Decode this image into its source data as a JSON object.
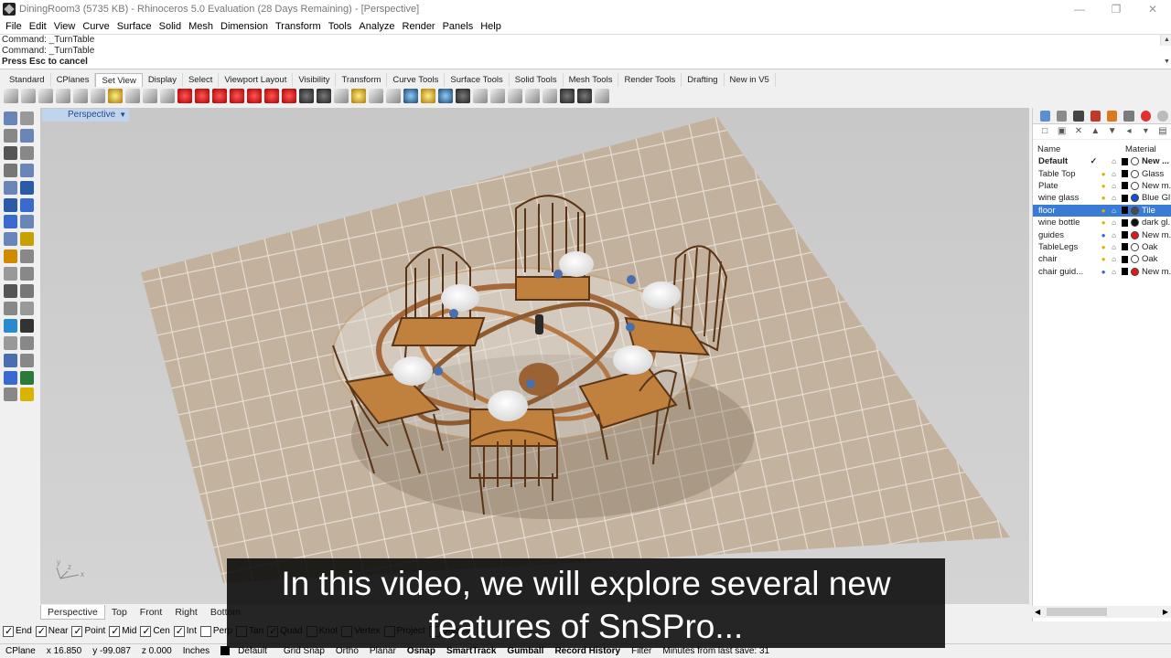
{
  "window": {
    "title": "DiningRoom3 (5735 KB) - Rhinoceros 5.0 Evaluation (28 Days Remaining) - [Perspective]",
    "minimize": "—",
    "maximize": "❐",
    "close": "✕"
  },
  "menu": [
    "File",
    "Edit",
    "View",
    "Curve",
    "Surface",
    "Solid",
    "Mesh",
    "Dimension",
    "Transform",
    "Tools",
    "Analyze",
    "Render",
    "Panels",
    "Help"
  ],
  "command": {
    "history": [
      "Command: _TurnTable",
      "Command: _TurnTable"
    ],
    "prompt": "Press Esc to cancel"
  },
  "toolbar_tabs": [
    "Standard",
    "CPlanes",
    "Set View",
    "Display",
    "Select",
    "Viewport Layout",
    "Visibility",
    "Transform",
    "Curve Tools",
    "Surface Tools",
    "Solid Tools",
    "Mesh Tools",
    "Render Tools",
    "Drafting",
    "New in V5"
  ],
  "toolbar_active_tab": "Set View",
  "viewport": {
    "label": "Perspective",
    "axis_x": "x",
    "axis_y": "y",
    "axis_z": "z"
  },
  "viewport_tabs": [
    "Perspective",
    "Top",
    "Front",
    "Right",
    "Bottom"
  ],
  "osnaps": [
    {
      "label": "End",
      "checked": true
    },
    {
      "label": "Near",
      "checked": true
    },
    {
      "label": "Point",
      "checked": true
    },
    {
      "label": "Mid",
      "checked": true
    },
    {
      "label": "Cen",
      "checked": true
    },
    {
      "label": "Int",
      "checked": true
    },
    {
      "label": "Perp",
      "checked": false
    },
    {
      "label": "Tan",
      "checked": false
    },
    {
      "label": "Quad",
      "checked": true
    },
    {
      "label": "Knot",
      "checked": false
    },
    {
      "label": "Vertex",
      "checked": false
    },
    {
      "label": "Project",
      "checked": false
    },
    {
      "label": "Disable",
      "checked": false
    }
  ],
  "status": {
    "cplane": "CPlane",
    "x": "x 16.850",
    "y": "y -99.087",
    "z": "z 0.000",
    "units": "Inches",
    "layer": "Default",
    "grid_snap": "Grid Snap",
    "ortho": "Ortho",
    "planar": "Planar",
    "osnap": "Osnap",
    "smarttrack": "SmartTrack",
    "gumball": "Gumball",
    "record_history": "Record History",
    "filter": "Filter",
    "save_msg": "Minutes from last save: 31"
  },
  "layers": {
    "header_name": "Name",
    "header_material": "Material",
    "rows": [
      {
        "name": "Default",
        "current": "✓",
        "color": "#000000",
        "material": "New ...",
        "mat_color": "#ffffff",
        "bulb": "",
        "selected": false,
        "is_default": true
      },
      {
        "name": "Table Top",
        "current": "",
        "color": "#000000",
        "material": "Glass",
        "mat_color": "#ffffff",
        "bulb": "yellow",
        "selected": false,
        "is_default": false
      },
      {
        "name": "Plate",
        "current": "",
        "color": "#000000",
        "material": "New m...",
        "mat_color": "#ffffff",
        "bulb": "yellow",
        "selected": false,
        "is_default": false
      },
      {
        "name": "wine glass",
        "current": "",
        "color": "#000000",
        "material": "Blue Gl...",
        "mat_color": "#1a4ad6",
        "bulb": "yellow",
        "selected": false,
        "is_default": false
      },
      {
        "name": "floor",
        "current": "",
        "color": "#000000",
        "material": "Tile",
        "mat_color": "#4a4a4a",
        "bulb": "yellow",
        "selected": true,
        "is_default": false
      },
      {
        "name": "wine bottle",
        "current": "",
        "color": "#000000",
        "material": "dark gl...",
        "mat_color": "#111111",
        "bulb": "yellow",
        "selected": false,
        "is_default": false
      },
      {
        "name": "guides",
        "current": "",
        "color": "#000000",
        "material": "New m...",
        "mat_color": "#e11919",
        "bulb": "blue",
        "selected": false,
        "is_default": false
      },
      {
        "name": "TableLegs",
        "current": "",
        "color": "#000000",
        "material": "Oak",
        "mat_color": "#ffffff",
        "bulb": "yellow",
        "selected": false,
        "is_default": false
      },
      {
        "name": "chair",
        "current": "",
        "color": "#000000",
        "material": "Oak",
        "mat_color": "#ffffff",
        "bulb": "yellow",
        "selected": false,
        "is_default": false
      },
      {
        "name": "chair guid...",
        "current": "",
        "color": "#000000",
        "material": "New m...",
        "mat_color": "#e11919",
        "bulb": "blue",
        "selected": false,
        "is_default": false
      }
    ]
  },
  "caption": {
    "line1": "In this video, we will explore several new",
    "line2": "features of SnSPro..."
  },
  "colors": {
    "accent": "#3a7bd5",
    "viewport_label_bg": "#c0d4ec",
    "floor_tile": "#c2b09a",
    "wood": "#c0803e"
  }
}
